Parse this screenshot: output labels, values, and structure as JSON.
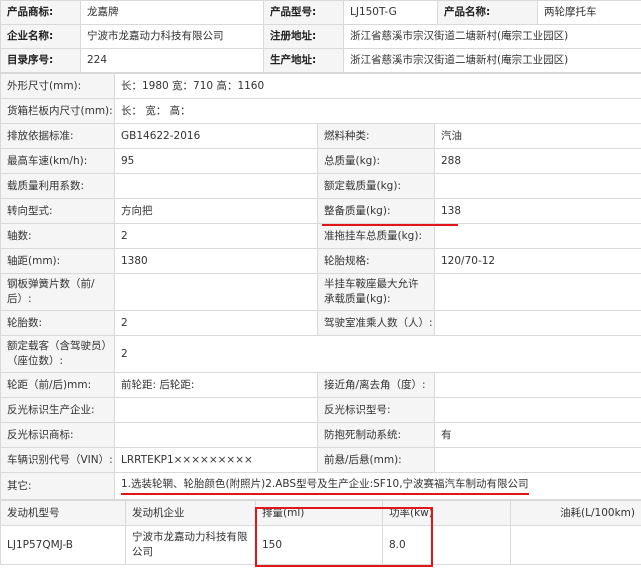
{
  "header": {
    "product_brand_label": "产品商标:",
    "product_brand": "龙嘉牌",
    "product_model_label": "产品型号:",
    "product_model": "LJ150T-G",
    "product_name_label": "产品名称:",
    "product_name": "两轮摩托车",
    "company_label": "企业名称:",
    "company": "宁波市龙嘉动力科技有限公司",
    "reg_address_label": "注册地址:",
    "reg_address": "浙江省慈溪市宗汉街道二塘新村(庵宗工业园区)",
    "catalog_no_label": "目录序号:",
    "catalog_no": "224",
    "prod_address_label": "生产地址:",
    "prod_address": "浙江省慈溪市宗汉街道二塘新村(庵宗工业园区)"
  },
  "specs": {
    "dimensions_label": "外形尺寸(mm):",
    "dimensions": "长：1980 宽：710 高：1160",
    "cargo_label": "货箱栏板内尺寸(mm):",
    "cargo": "长：  宽：  高：",
    "emission_label": "排放依据标准:",
    "emission": "GB14622-2016",
    "fuel_label": "燃料种类:",
    "fuel": "汽油",
    "top_speed_label": "最高车速(km/h):",
    "top_speed": "95",
    "total_mass_label": "总质量(kg):",
    "total_mass": "288",
    "load_util_label": "载质量利用系数:",
    "load_util": "",
    "rated_load_label": "额定载质量(kg):",
    "rated_load": "",
    "steering_label": "转向型式:",
    "steering": "方向把",
    "curb_mass_label": "整备质量(kg):",
    "curb_mass": "138",
    "axles_label": "轴数:",
    "axles": "2",
    "trailer_mass_label": "准拖挂车总质量(kg):",
    "trailer_mass": "",
    "wheelbase_label": "轴距(mm):",
    "wheelbase": "1380",
    "tire_label": "轮胎规格:",
    "tire": "120/70-12",
    "spring_label": "钢板弹簧片数（前/后）:",
    "spring": "",
    "semi_trailer_label": "半挂车鞍座最大允许承载质量(kg):",
    "semi_trailer": "",
    "tires_count_label": "轮胎数:",
    "tires_count": "2",
    "cab_seats_label": "驾驶室准乘人数（人）:",
    "cab_seats": "",
    "passengers_label": "额定载客（含驾驶员）（座位数）:",
    "passengers": "2",
    "track_label": "轮距（前/后)mm:",
    "track": "前轮距: 后轮距:",
    "approach_label": "接近角/离去角（度）:",
    "approach": "",
    "reflector_maker_label": "反光标识生产企业:",
    "reflector_maker": "",
    "reflector_model_label": "反光标识型号:",
    "reflector_model": "",
    "reflector_brand_label": "反光标识商标:",
    "reflector_brand": "",
    "abs_label": "防抱死制动系统:",
    "abs": "有",
    "vin_label": "车辆识别代号（VIN）:",
    "vin": "LRRTEKP1×××××××××",
    "overhang_label": "前悬/后悬(mm):",
    "overhang": "",
    "remark_label": "其它:",
    "remark": "1.选装轮辋、轮胎颜色(附照片)2.ABS型号及生产企业:SF10,宁波赛福汽车制动有限公司"
  },
  "engine": {
    "headers": {
      "model": "发动机型号",
      "maker": "发动机企业",
      "displacement": "排量(ml)",
      "power": "功率(kw)",
      "fuel_consumption": "油耗(L/100km)"
    },
    "row": {
      "model": "LJ1P57QMJ-B",
      "maker": "宁波市龙嘉动力科技有限公司",
      "displacement": "150",
      "power": "8.0",
      "fuel_consumption": ""
    }
  },
  "colors": {
    "highlight": "#e0161b",
    "label_bg": "#f5f5f5",
    "border": "#d9d9d9"
  }
}
